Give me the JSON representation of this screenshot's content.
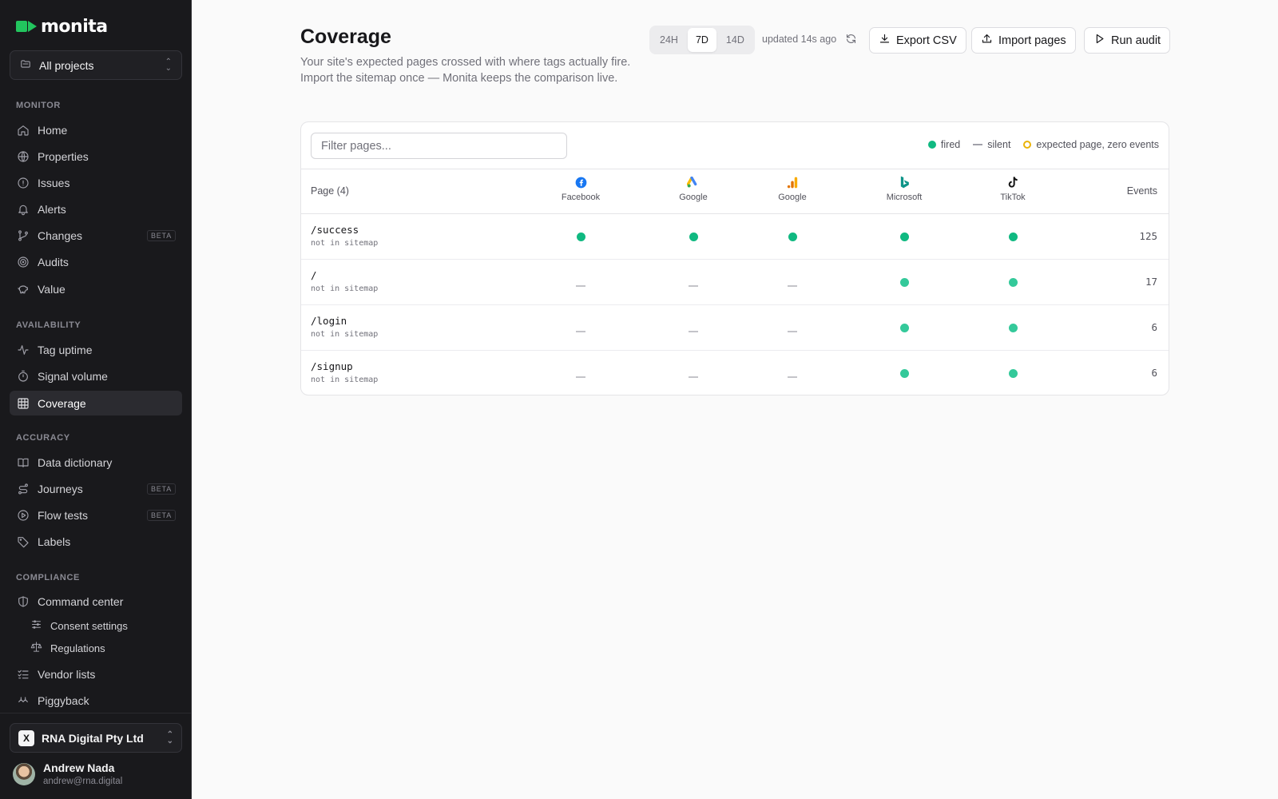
{
  "brand": {
    "name": "monita",
    "accent": "#22c55e"
  },
  "project_select": {
    "label": "All projects"
  },
  "nav": {
    "monitor": {
      "title": "MONITOR",
      "items": [
        {
          "label": "Home",
          "icon": "home-icon"
        },
        {
          "label": "Properties",
          "icon": "globe-icon"
        },
        {
          "label": "Issues",
          "icon": "alert-circle-icon"
        },
        {
          "label": "Alerts",
          "icon": "bell-icon"
        },
        {
          "label": "Changes",
          "icon": "git-branch-icon",
          "badge": "BETA"
        },
        {
          "label": "Audits",
          "icon": "target-icon"
        },
        {
          "label": "Value",
          "icon": "piggy-bank-icon"
        }
      ]
    },
    "availability": {
      "title": "AVAILABILITY",
      "items": [
        {
          "label": "Tag uptime",
          "icon": "activity-icon"
        },
        {
          "label": "Signal volume",
          "icon": "timer-icon"
        },
        {
          "label": "Coverage",
          "icon": "grid-icon"
        }
      ]
    },
    "accuracy": {
      "title": "ACCURACY",
      "items": [
        {
          "label": "Data dictionary",
          "icon": "book-icon"
        },
        {
          "label": "Journeys",
          "icon": "route-icon",
          "badge": "BETA"
        },
        {
          "label": "Flow tests",
          "icon": "play-circle-icon",
          "badge": "BETA"
        },
        {
          "label": "Labels",
          "icon": "tag-icon"
        }
      ]
    },
    "compliance": {
      "title": "COMPLIANCE",
      "items": [
        {
          "label": "Command center",
          "icon": "shield-icon"
        },
        {
          "label": "Consent settings",
          "icon": "sliders-icon"
        },
        {
          "label": "Regulations",
          "icon": "scale-icon"
        },
        {
          "label": "Vendor lists",
          "icon": "list-checks-icon"
        },
        {
          "label": "Piggyback",
          "icon": "piggyback-icon"
        }
      ]
    }
  },
  "org": {
    "name": "RNA Digital Pty Ltd",
    "logo_text": "X"
  },
  "user": {
    "name": "Andrew Nada",
    "email": "andrew@rna.digital"
  },
  "header": {
    "title": "Coverage",
    "description": "Your site's expected pages crossed with where tags actually fire. Import the sitemap once — Monita keeps the comparison live.",
    "ranges": [
      "24H",
      "7D",
      "14D"
    ],
    "active_range": "7D",
    "updated": "updated 14s ago",
    "export_label": "Export CSV",
    "import_label": "Import pages",
    "audit_label": "Run audit"
  },
  "table": {
    "filter_placeholder": "Filter pages...",
    "legend": {
      "fired": "fired",
      "silent": "silent",
      "expected": "expected page, zero events"
    },
    "page_header": "Page (4)",
    "events_header": "Events",
    "vendors": [
      {
        "name": "Facebook",
        "icon": "facebook-icon"
      },
      {
        "name": "Google",
        "icon": "google-ads-icon"
      },
      {
        "name": "Google",
        "icon": "google-analytics-icon"
      },
      {
        "name": "Microsoft",
        "icon": "bing-icon"
      },
      {
        "name": "TikTok",
        "icon": "tiktok-icon"
      }
    ],
    "rows": [
      {
        "path": "/success",
        "note": "not in sitemap",
        "status": [
          "fired",
          "fired",
          "fired",
          "fired",
          "fired"
        ],
        "events": "125"
      },
      {
        "path": "/",
        "note": "not in sitemap",
        "status": [
          "silent",
          "silent",
          "silent",
          "fired",
          "fired"
        ],
        "events": "17"
      },
      {
        "path": "/login",
        "note": "not in sitemap",
        "status": [
          "silent",
          "silent",
          "silent",
          "fired",
          "fired"
        ],
        "events": "6"
      },
      {
        "path": "/signup",
        "note": "not in sitemap",
        "status": [
          "silent",
          "silent",
          "silent",
          "fired",
          "fired"
        ],
        "events": "6"
      }
    ]
  },
  "colors": {
    "fired": "#10b981",
    "silent": "#c4c4c9",
    "expected": "#eab308"
  }
}
